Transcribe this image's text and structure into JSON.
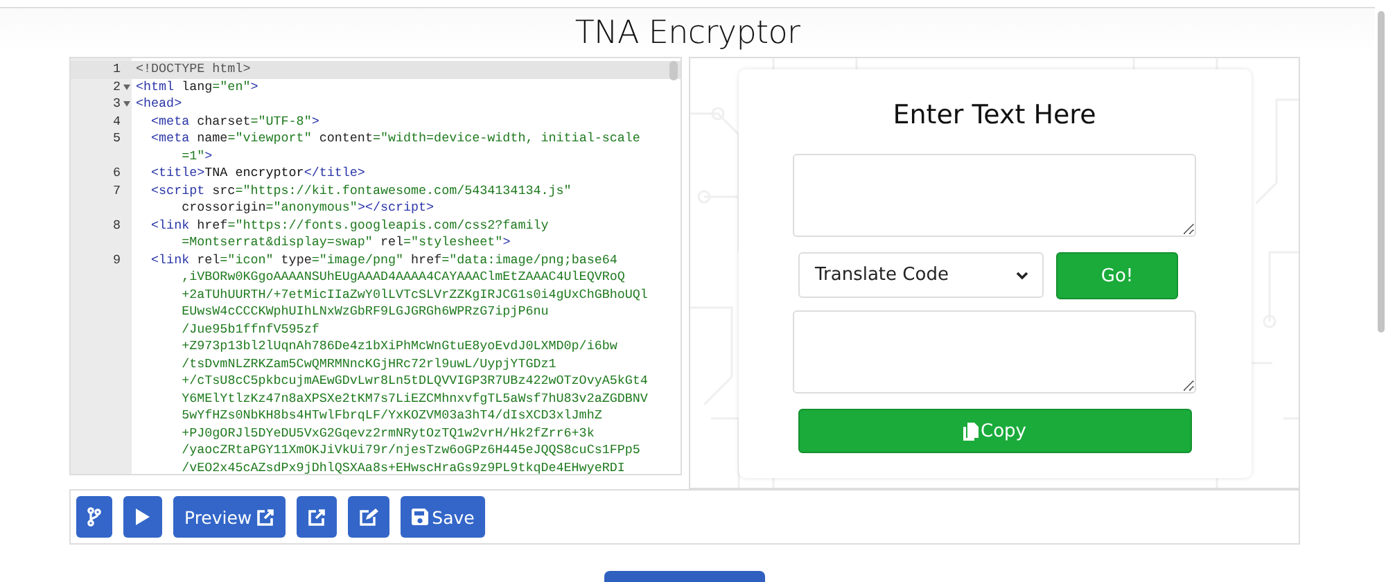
{
  "title": "TNA Encryptor",
  "editor": {
    "lines": [
      {
        "number": "1",
        "active": true,
        "foldable": false,
        "rows": [
          {
            "segments": [
              {
                "kind": "doctype",
                "text": "<!DOCTYPE html>"
              }
            ]
          }
        ]
      },
      {
        "number": "2",
        "active": false,
        "foldable": true,
        "rows": [
          {
            "segments": [
              {
                "kind": "tag",
                "text": "<html"
              },
              {
                "kind": "attr",
                "text": " lang"
              },
              {
                "kind": "value",
                "text": "=\"en\""
              },
              {
                "kind": "tag",
                "text": ">"
              }
            ]
          }
        ]
      },
      {
        "number": "3",
        "active": false,
        "foldable": true,
        "rows": [
          {
            "segments": [
              {
                "kind": "tag",
                "text": "<head>"
              }
            ]
          }
        ],
        "children": [
          {
            "number": "4",
            "active": false,
            "foldable": false,
            "rows": [
              {
                "segments": [
                  {
                    "kind": "tag",
                    "text": "<meta"
                  },
                  {
                    "kind": "attr",
                    "text": " charset"
                  },
                  {
                    "kind": "value",
                    "text": "=\"UTF-8\""
                  },
                  {
                    "kind": "tag",
                    "text": ">"
                  }
                ]
              }
            ]
          },
          {
            "number": "5",
            "active": false,
            "foldable": false,
            "rows": [
              {
                "segments": [
                  {
                    "kind": "tag",
                    "text": "<meta"
                  },
                  {
                    "kind": "attr",
                    "text": " name"
                  },
                  {
                    "kind": "value",
                    "text": "=\"viewport\""
                  },
                  {
                    "kind": "attr",
                    "text": " content"
                  },
                  {
                    "kind": "value",
                    "text": "=\"width=device-width, initial-scale"
                  }
                ]
              },
              {
                "segments": [
                  {
                    "kind": "value",
                    "text": "=1\""
                  },
                  {
                    "kind": "tag",
                    "text": ">"
                  }
                ]
              }
            ]
          },
          {
            "number": "6",
            "active": false,
            "foldable": false,
            "rows": [
              {
                "segments": [
                  {
                    "kind": "tag",
                    "text": "<title>"
                  },
                  {
                    "kind": "text",
                    "text": "TNA encryptor"
                  },
                  {
                    "kind": "tag",
                    "text": "</title>"
                  }
                ]
              }
            ]
          },
          {
            "number": "7",
            "active": false,
            "foldable": false,
            "rows": [
              {
                "segments": [
                  {
                    "kind": "tag",
                    "text": "<script"
                  },
                  {
                    "kind": "attr",
                    "text": " src"
                  },
                  {
                    "kind": "value",
                    "text": "=\"https://kit.fontawesome.com/5434134134.js\""
                  }
                ]
              },
              {
                "segments": [
                  {
                    "kind": "attr",
                    "text": "crossorigin"
                  },
                  {
                    "kind": "value",
                    "text": "=\"anonymous\""
                  },
                  {
                    "kind": "tag",
                    "text": "></script>"
                  }
                ]
              }
            ]
          },
          {
            "number": "8",
            "active": false,
            "foldable": false,
            "rows": [
              {
                "segments": [
                  {
                    "kind": "tag",
                    "text": "<link"
                  },
                  {
                    "kind": "attr",
                    "text": " href"
                  },
                  {
                    "kind": "value",
                    "text": "=\"https://fonts.googleapis.com/css2?family"
                  }
                ]
              },
              {
                "segments": [
                  {
                    "kind": "value",
                    "text": "=Montserrat&display=swap\""
                  },
                  {
                    "kind": "attr",
                    "text": " rel"
                  },
                  {
                    "kind": "value",
                    "text": "=\"stylesheet\""
                  },
                  {
                    "kind": "tag",
                    "text": ">"
                  }
                ]
              }
            ]
          },
          {
            "number": "9",
            "active": false,
            "foldable": false,
            "rows": [
              {
                "segments": [
                  {
                    "kind": "tag",
                    "text": "<link"
                  },
                  {
                    "kind": "attr",
                    "text": " rel"
                  },
                  {
                    "kind": "value",
                    "text": "=\"icon\""
                  },
                  {
                    "kind": "attr",
                    "text": " type"
                  },
                  {
                    "kind": "value",
                    "text": "=\"image/png\""
                  },
                  {
                    "kind": "attr",
                    "text": " href"
                  },
                  {
                    "kind": "value",
                    "text": "=\"data:image/png;base64"
                  }
                ]
              },
              {
                "segments": [
                  {
                    "kind": "value",
                    "text": ",iVBORw0KGgoAAAANSUhEUgAAAD4AAAA4CAYAAAClmEtZAAAC4UlEQVRoQ"
                  }
                ]
              },
              {
                "segments": [
                  {
                    "kind": "value",
                    "text": "+2aTUhUURTH/+7etMicIIaZwY0lLVTcSLVrZZKgIRJCG1s0i4gUxChGBhoUQl"
                  }
                ]
              },
              {
                "segments": [
                  {
                    "kind": "value",
                    "text": "EUwsW4cCCCKWphUIhLNxWzGbRF9LGJGRGh6WPRzG7ipjP6nu"
                  }
                ]
              },
              {
                "segments": [
                  {
                    "kind": "value",
                    "text": "/Jue95b1ffnfV595zf"
                  }
                ]
              },
              {
                "segments": [
                  {
                    "kind": "value",
                    "text": "+Z973p13bl2lUqnAh786De4z1bXiPhMcWnGtuE8yoEvdJ0LXMD0p/i6bw"
                  }
                ]
              },
              {
                "segments": [
                  {
                    "kind": "value",
                    "text": "/tsDvmNLZRKZam5CwQMRMNncKGjHRc72rl9uwL/UypjYTGDz1"
                  }
                ]
              },
              {
                "segments": [
                  {
                    "kind": "value",
                    "text": "+/cTsU8cC5pkbcujmAEwGDvLwr8Ln5tDLQVVIGP3R7UBz422wOTzOvyA5kGt4"
                  }
                ]
              },
              {
                "segments": [
                  {
                    "kind": "value",
                    "text": "Y6MElYtlzKz47n8aXPSXe2tKM7s7LiEZCMhnxvfgTL5aWsf7hU83v2aZGDBNV"
                  }
                ]
              },
              {
                "segments": [
                  {
                    "kind": "value",
                    "text": "5wYfHZs0NbKH8bs4HTwlFbrqLF/YxKOZVM03a3hT4/dIsXCD3xlJmhZ"
                  }
                ]
              },
              {
                "segments": [
                  {
                    "kind": "value",
                    "text": "+PJ0gORJl5DYeDU5VxG2Gqevz2rmNRytOzTQ1w2vrH/Hk2fZrr6+3k"
                  }
                ]
              },
              {
                "segments": [
                  {
                    "kind": "value",
                    "text": "/yaocZRtaPGY11XmOKJiVkUi79r/njesTzw6oGPz6H445eJQQS8cuCs1FPp5"
                  }
                ]
              },
              {
                "segments": [
                  {
                    "kind": "value",
                    "text": "/vEO2x45cAZsdPx9jDhlQSXAa8s+EHwscHraGs9z9PL9tkqDe4EHwyeRDI"
                  }
                ]
              }
            ]
          }
        ]
      }
    ]
  },
  "preview": {
    "heading": "Enter Text Here",
    "select": {
      "value": "Translate Code"
    },
    "go_button": "Go!",
    "copy_button": "Copy"
  },
  "toolbar": {
    "buttons": [
      {
        "kind": "fork"
      },
      {
        "kind": "run"
      },
      {
        "kind": "preview",
        "label": "Preview"
      },
      {
        "kind": "open"
      },
      {
        "kind": "edit"
      },
      {
        "kind": "save",
        "label": "Save"
      }
    ]
  }
}
